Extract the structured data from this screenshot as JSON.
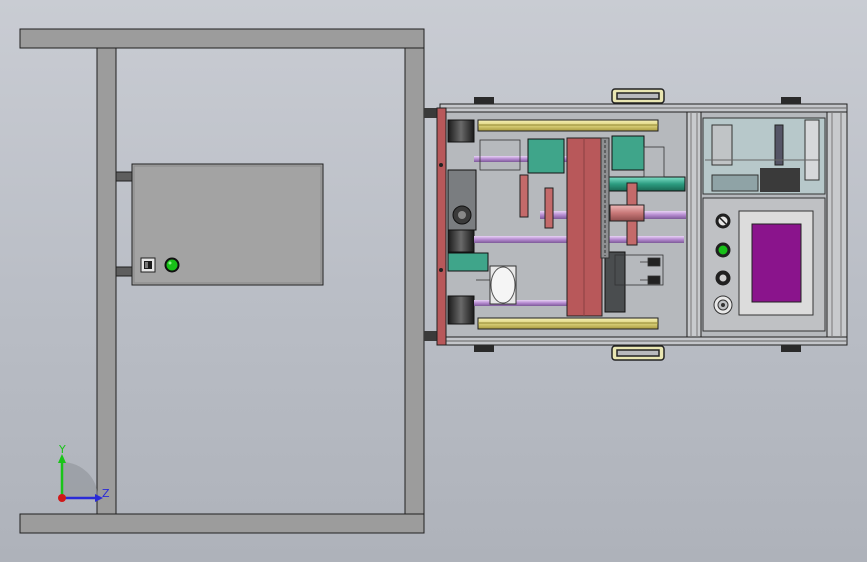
{
  "viewport": {
    "background_top": "#c9ccd3",
    "background_bottom": "#aeb2ba"
  },
  "triad": {
    "y_label": "Y",
    "z_label": "Z",
    "y_color": "#19c419",
    "z_color": "#2a2ad8",
    "origin_color": "#d01818"
  },
  "colors": {
    "frame": "#9a9a9a",
    "frame_edge": "#202020",
    "panel": "#a2a2a2",
    "machine_body": "#b9bcc0",
    "red_plate": "#b8585a",
    "teal_block": "#3fa58a",
    "purple_rod": "#c9a4e0",
    "yellow_bar": "#e8e090",
    "screen": "#8a148c",
    "green_light": "#18c018"
  },
  "panel": {
    "switch_icon": "rocker-switch-icon",
    "light_icon": "green-indicator-light-icon"
  }
}
